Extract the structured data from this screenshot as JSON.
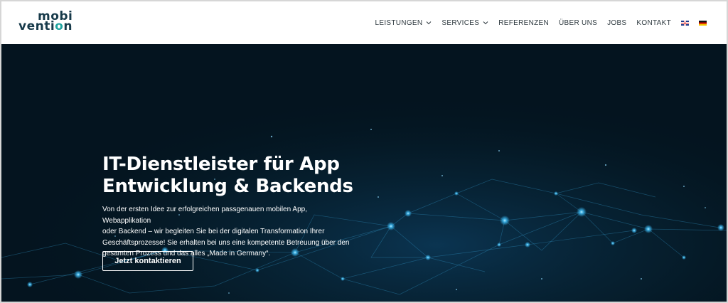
{
  "brand": {
    "logo_line1": "mobi",
    "logo_line2_a": "venti",
    "logo_line2_o": "o",
    "logo_line2_b": "n"
  },
  "nav": {
    "items": [
      {
        "label": "LEISTUNGEN",
        "dropdown": true
      },
      {
        "label": "SERVICES",
        "dropdown": true
      },
      {
        "label": "REFERENZEN",
        "dropdown": false
      },
      {
        "label": "ÜBER UNS",
        "dropdown": false
      },
      {
        "label": "JOBS",
        "dropdown": false
      },
      {
        "label": "KONTAKT",
        "dropdown": false
      }
    ],
    "languages": [
      "uk-flag-icon",
      "de-flag-icon"
    ]
  },
  "hero": {
    "headline_line1": "IT-Dienstleister für App",
    "headline_line2": "Entwicklung & Backends",
    "intro_lines": [
      "Von der ersten Idee zur erfolgreichen passgenauen mobilen App, Webapplikation",
      "oder Backend – wir begleiten Sie bei der digitalen Transformation Ihrer",
      "Geschäftsprozesse! Sie erhalten bei uns eine kompetente Betreuung über den",
      "gesamten Prozess und das alles „Made in Germany“."
    ],
    "cta_label": "Jetzt kontaktieren"
  },
  "colors": {
    "header_bg": "#ffffff",
    "nav_text": "#2f3a40",
    "logo_dark": "#173a4a",
    "logo_accent": "#1fa4a0",
    "hero_bg": "#04141f",
    "glow": "#3fc3ff",
    "text_on_hero": "#ffffff"
  }
}
